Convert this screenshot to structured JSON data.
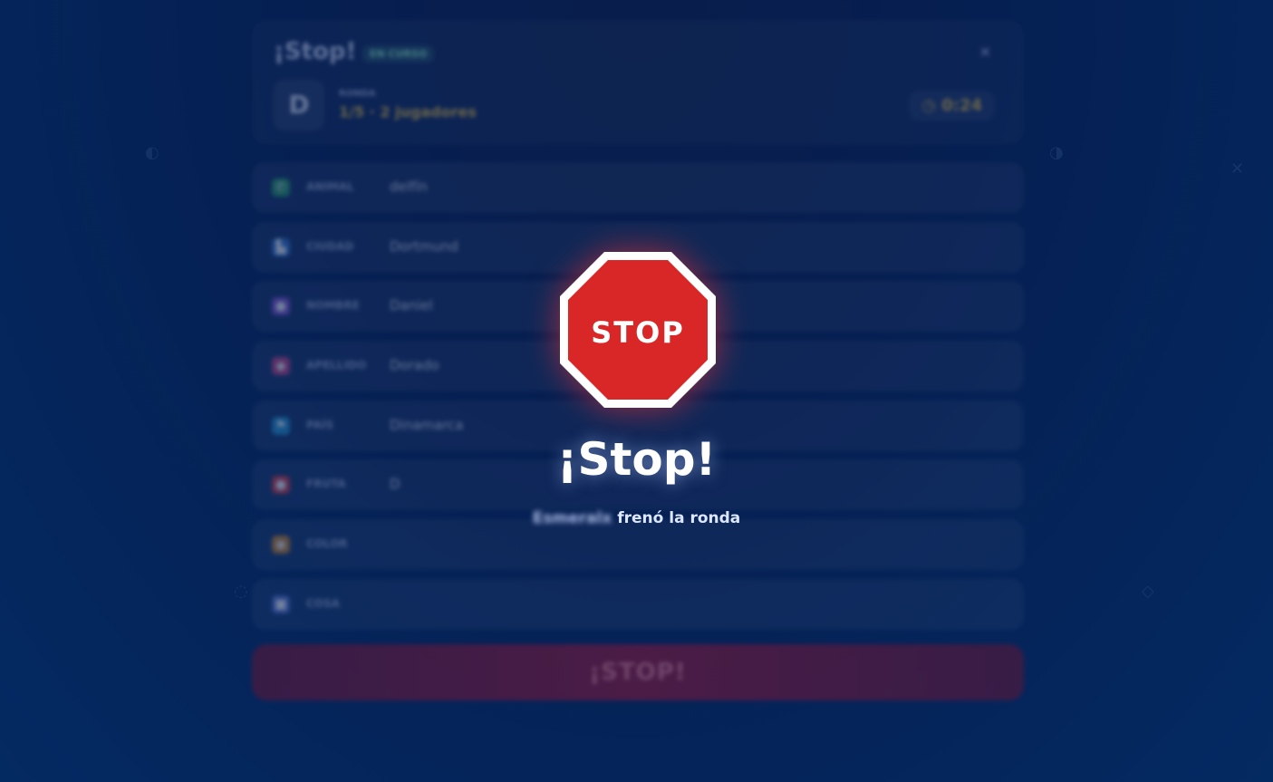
{
  "header": {
    "brand": "¡Stop!",
    "status_badge": "EN CURSO",
    "close_icon": "close-icon",
    "current_letter": "D",
    "round_label": "RONDA",
    "round_info": "1/5 · 2 jugadores",
    "timer_icon": "clock-icon",
    "timer": "0:24"
  },
  "rows": [
    {
      "icon": "phone-icon",
      "label": "ANIMAL",
      "value": "delfín",
      "color": "#2fa36b"
    },
    {
      "icon": "city-icon",
      "label": "CIUDAD",
      "value": "Dortmund",
      "color": "#3b7dd8"
    },
    {
      "icon": "person-icon",
      "label": "NOMBRE",
      "value": "Daniel",
      "color": "#8a5bd6"
    },
    {
      "icon": "tag-icon",
      "label": "APELLIDO",
      "value": "Dorado",
      "color": "#d24b8a"
    },
    {
      "icon": "flag-icon",
      "label": "PAÍS",
      "value": "Dinamarca",
      "color": "#2b9bd8"
    },
    {
      "icon": "fruit-icon",
      "label": "FRUTA",
      "value": "D",
      "color": "#e0414b"
    },
    {
      "icon": "palette-icon",
      "label": "COLOR",
      "value": "",
      "color": "#d58a2b"
    },
    {
      "icon": "box-icon",
      "label": "COSA",
      "value": "",
      "color": "#5b7ad6"
    }
  ],
  "stop_button": "¡STOP!",
  "overlay": {
    "sign_text": "STOP",
    "title": "¡Stop!",
    "player_name": "Esmeralx",
    "subtitle_suffix": " frenó la ronda",
    "sign_color": "#d92626"
  }
}
